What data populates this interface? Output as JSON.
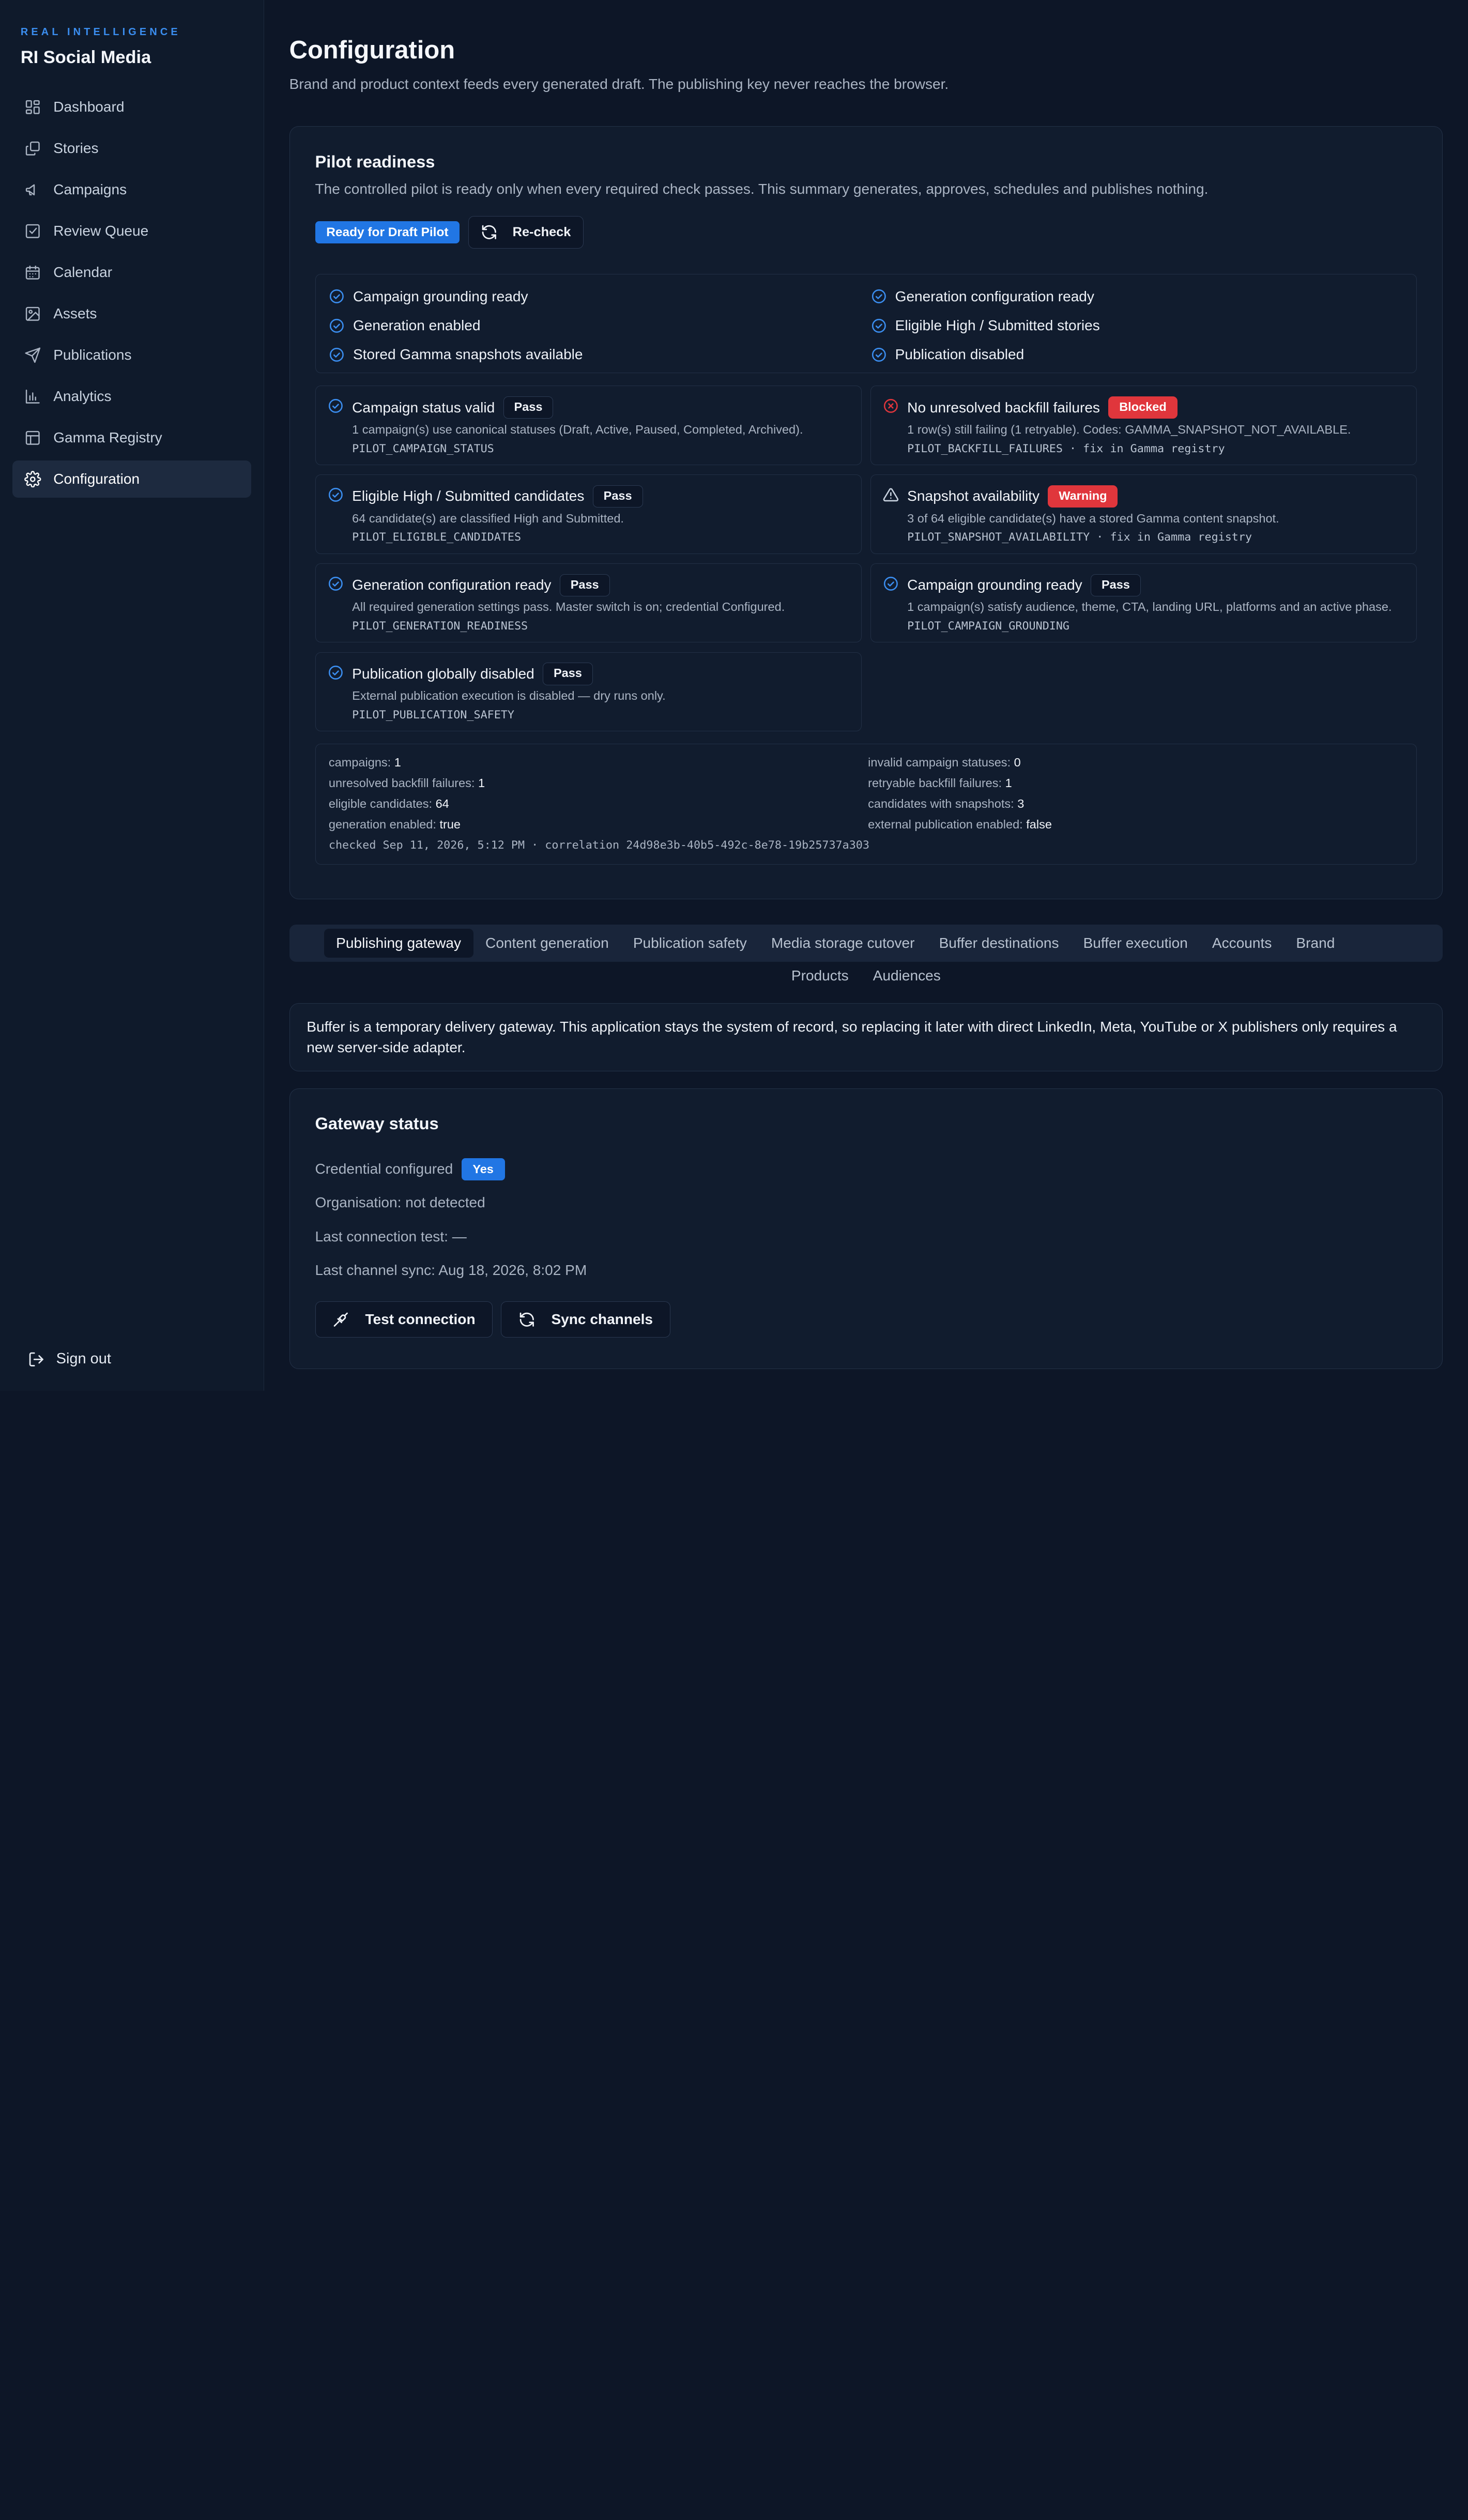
{
  "brand": {
    "kicker": "REAL INTELLIGENCE",
    "name": "RI Social Media"
  },
  "nav": [
    {
      "label": "Dashboard",
      "icon": "dashboard-icon"
    },
    {
      "label": "Stories",
      "icon": "stories-icon"
    },
    {
      "label": "Campaigns",
      "icon": "megaphone-icon"
    },
    {
      "label": "Review Queue",
      "icon": "review-check-icon"
    },
    {
      "label": "Calendar",
      "icon": "calendar-icon"
    },
    {
      "label": "Assets",
      "icon": "image-icon"
    },
    {
      "label": "Publications",
      "icon": "send-icon"
    },
    {
      "label": "Analytics",
      "icon": "bar-chart-icon"
    },
    {
      "label": "Gamma Registry",
      "icon": "table-icon"
    },
    {
      "label": "Configuration",
      "icon": "gear-icon",
      "active": true
    }
  ],
  "signout": "Sign out",
  "page": {
    "title": "Configuration",
    "subtitle": "Brand and product context feeds every generated draft. The publishing key never reaches the browser."
  },
  "readiness": {
    "title": "Pilot readiness",
    "subtitle": "The controlled pilot is ready only when every required check passes. This summary generates, approves, schedules and publishes nothing.",
    "status_badge": "Ready for Draft Pilot",
    "recheck_label": "Re-check",
    "summary": [
      "Campaign grounding ready",
      "Generation configuration ready",
      "Generation enabled",
      "Eligible High / Submitted stories",
      "Stored Gamma snapshots available",
      "Publication disabled"
    ],
    "checks": [
      {
        "title": "Campaign status valid",
        "status": "Pass",
        "kind": "pass",
        "desc": "1 campaign(s) use canonical statuses (Draft, Active, Paused, Completed, Archived).",
        "code": "PILOT_CAMPAIGN_STATUS"
      },
      {
        "title": "No unresolved backfill failures",
        "status": "Blocked",
        "kind": "blocked",
        "desc": "1 row(s) still failing (1 retryable). Codes: GAMMA_SNAPSHOT_NOT_AVAILABLE.",
        "code": "PILOT_BACKFILL_FAILURES · fix in Gamma registry"
      },
      {
        "title": "Eligible High / Submitted candidates",
        "status": "Pass",
        "kind": "pass",
        "desc": "64 candidate(s) are classified High and Submitted.",
        "code": "PILOT_ELIGIBLE_CANDIDATES"
      },
      {
        "title": "Snapshot availability",
        "status": "Warning",
        "kind": "warning",
        "desc": "3 of 64 eligible candidate(s) have a stored Gamma content snapshot.",
        "code": "PILOT_SNAPSHOT_AVAILABILITY · fix in Gamma registry"
      },
      {
        "title": "Generation configuration ready",
        "status": "Pass",
        "kind": "pass",
        "desc": "All required generation settings pass. Master switch is on; credential Configured.",
        "code": "PILOT_GENERATION_READINESS"
      },
      {
        "title": "Campaign grounding ready",
        "status": "Pass",
        "kind": "pass",
        "desc": "1 campaign(s) satisfy audience, theme, CTA, landing URL, platforms and an active phase.",
        "code": "PILOT_CAMPAIGN_GROUNDING"
      },
      {
        "title": "Publication globally disabled",
        "status": "Pass",
        "kind": "pass",
        "desc": "External publication execution is disabled — dry runs only.",
        "code": "PILOT_PUBLICATION_SAFETY"
      }
    ],
    "stats": [
      {
        "label": "campaigns:",
        "value": "1"
      },
      {
        "label": "invalid campaign statuses:",
        "value": "0"
      },
      {
        "label": "unresolved backfill failures:",
        "value": "1"
      },
      {
        "label": "retryable backfill failures:",
        "value": "1"
      },
      {
        "label": "eligible candidates:",
        "value": "64"
      },
      {
        "label": "candidates with snapshots:",
        "value": "3"
      },
      {
        "label": "generation enabled:",
        "value": "true"
      },
      {
        "label": "external publication enabled:",
        "value": "false"
      }
    ],
    "footer": "checked Sep 11, 2026, 5:12 PM · correlation 24d98e3b-40b5-492c-8e78-19b25737a303"
  },
  "tabs": {
    "row1": [
      "Publishing gateway",
      "Content generation",
      "Publication safety",
      "Media storage cutover",
      "Buffer destinations",
      "Buffer execution",
      "Accounts",
      "Brand"
    ],
    "row2": [
      "Products",
      "Audiences"
    ],
    "active": "Publishing gateway"
  },
  "note": "Buffer is a temporary delivery gateway. This application stays the system of record, so replacing it later with direct LinkedIn, Meta, YouTube or X publishers only requires a new server-side adapter.",
  "gateway": {
    "title": "Gateway status",
    "credential_label": "Credential configured",
    "credential_value": "Yes",
    "organisation": "Organisation: not detected",
    "last_test": "Last connection test: —",
    "last_sync": "Last channel sync: Aug 18, 2026, 8:02 PM",
    "test_button": "Test connection",
    "sync_button": "Sync channels"
  },
  "colors": {
    "accent": "#2176e4",
    "danger": "#e0363c",
    "background": "#0d1627",
    "check": "#3b8ef0"
  }
}
